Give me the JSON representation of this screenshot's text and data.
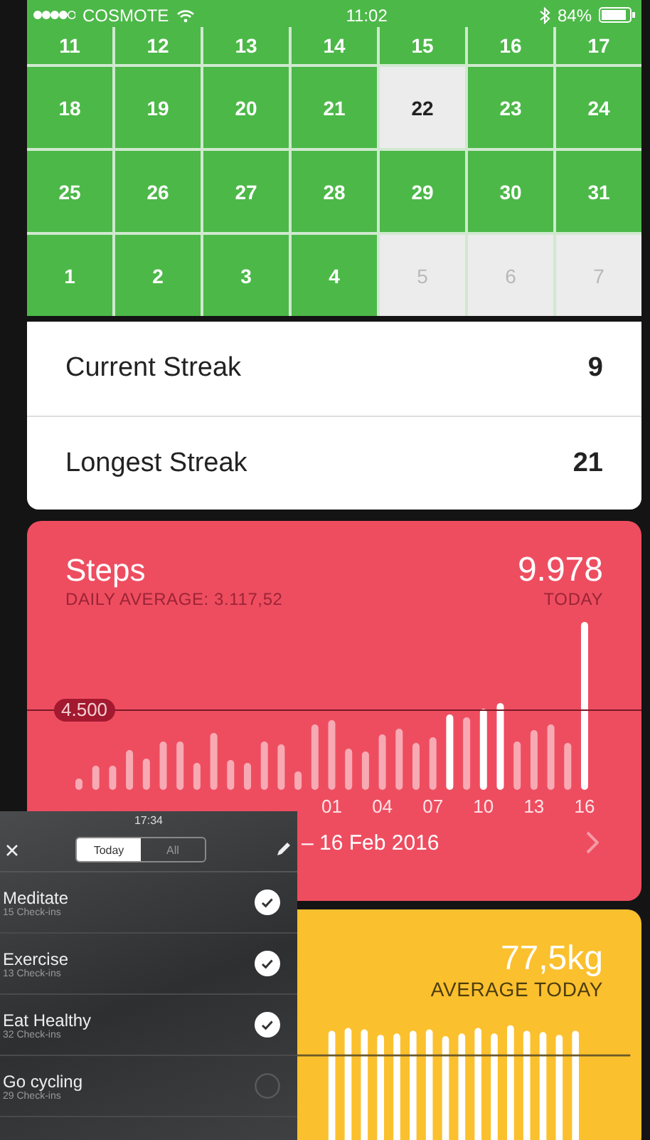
{
  "status_bar": {
    "carrier": "COSMOTE",
    "time": "11:02",
    "battery": "84%"
  },
  "calendar": {
    "weeks": [
      [
        {
          "label": "11",
          "kind": "done"
        },
        {
          "label": "12",
          "kind": "done"
        },
        {
          "label": "13",
          "kind": "done"
        },
        {
          "label": "14",
          "kind": "done"
        },
        {
          "label": "15",
          "kind": "done"
        },
        {
          "label": "16",
          "kind": "done"
        },
        {
          "label": "17",
          "kind": "done"
        }
      ],
      [
        {
          "label": "18",
          "kind": "done"
        },
        {
          "label": "19",
          "kind": "done"
        },
        {
          "label": "20",
          "kind": "done"
        },
        {
          "label": "21",
          "kind": "done"
        },
        {
          "label": "22",
          "kind": "today"
        },
        {
          "label": "23",
          "kind": "done"
        },
        {
          "label": "24",
          "kind": "done"
        }
      ],
      [
        {
          "label": "25",
          "kind": "done"
        },
        {
          "label": "26",
          "kind": "done"
        },
        {
          "label": "27",
          "kind": "done"
        },
        {
          "label": "28",
          "kind": "done"
        },
        {
          "label": "29",
          "kind": "done"
        },
        {
          "label": "30",
          "kind": "done"
        },
        {
          "label": "31",
          "kind": "done"
        }
      ],
      [
        {
          "label": "1",
          "kind": "done"
        },
        {
          "label": "2",
          "kind": "done"
        },
        {
          "label": "3",
          "kind": "done"
        },
        {
          "label": "4",
          "kind": "done"
        },
        {
          "label": "5",
          "kind": "future"
        },
        {
          "label": "6",
          "kind": "future"
        },
        {
          "label": "7",
          "kind": "future"
        }
      ]
    ]
  },
  "streaks": [
    {
      "label": "Current Streak",
      "value": "9"
    },
    {
      "label": "Longest Streak",
      "value": "21"
    }
  ],
  "steps_card": {
    "title": "Steps",
    "subtitle": "DAILY AVERAGE: 3.117,52",
    "value": "9.978",
    "value_label": "TODAY",
    "goal_label": "4.500",
    "x_labels": [
      "01",
      "04",
      "07",
      "10",
      "13",
      "16"
    ],
    "date_range": "– 16 Feb 2016"
  },
  "weight_card": {
    "value": "77,5kg",
    "value_label": "AVERAGE TODAY"
  },
  "habits_panel": {
    "time": "17:34",
    "tabs": [
      {
        "label": "Today",
        "selected": true
      },
      {
        "label": "All",
        "selected": false
      }
    ],
    "habits": [
      {
        "name": "Meditate",
        "count": "15 Check-ins",
        "checked": true
      },
      {
        "name": "Exercise",
        "count": "13 Check-ins",
        "checked": true
      },
      {
        "name": "Eat Healthy",
        "count": "32 Check-ins",
        "checked": true
      },
      {
        "name": "Go cycling",
        "count": "29 Check-ins",
        "checked": false
      }
    ]
  }
}
